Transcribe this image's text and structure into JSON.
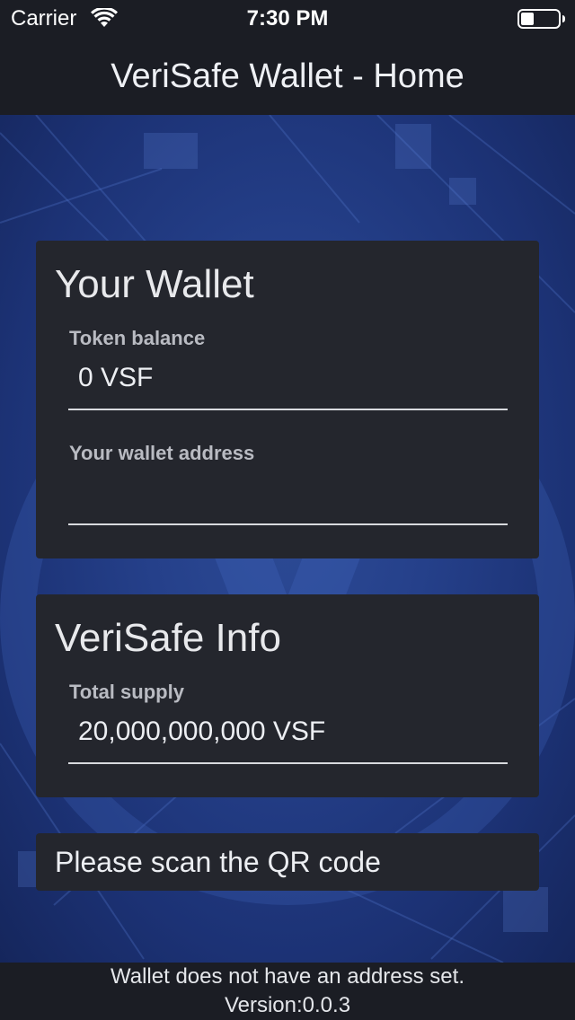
{
  "status_bar": {
    "carrier": "Carrier",
    "time": "7:30 PM",
    "icons": [
      "wifi-icon",
      "battery-icon"
    ]
  },
  "nav": {
    "title": "VeriSafe Wallet - Home"
  },
  "wallet_card": {
    "title": "Your Wallet",
    "token_balance_label": "Token balance",
    "token_balance_value": "0 VSF",
    "address_label": "Your wallet address",
    "address_value": ""
  },
  "info_card": {
    "title": "VeriSafe Info",
    "total_supply_label": "Total supply",
    "total_supply_value": "20,000,000,000 VSF"
  },
  "scan": {
    "label": "Please scan the QR code"
  },
  "footer": {
    "message": "Wallet does not have an address set.",
    "version": "Version:0.0.3"
  },
  "colors": {
    "bar_background": "#1b1d24",
    "card_background": "#24262d",
    "background_blue": "#25408a"
  }
}
